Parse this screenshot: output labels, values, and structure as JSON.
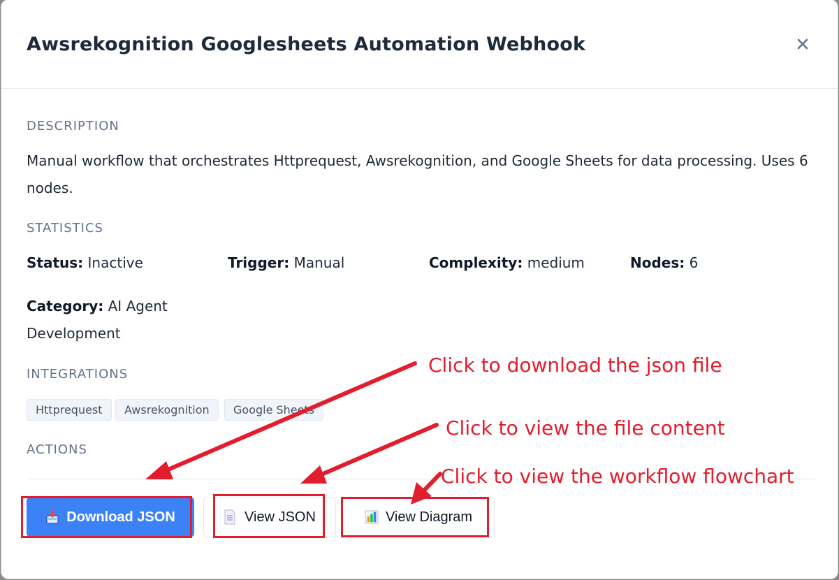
{
  "modal": {
    "title": "Awsrekognition Googlesheets Automation Webhook",
    "close_glyph": "×"
  },
  "description": {
    "label": "DESCRIPTION",
    "text": "Manual workflow that orchestrates Httprequest, Awsrekognition, and Google Sheets for data processing. Uses 6 nodes."
  },
  "statistics": {
    "label": "STATISTICS",
    "status": {
      "key": "Status:",
      "value": "Inactive"
    },
    "trigger": {
      "key": "Trigger:",
      "value": "Manual"
    },
    "complexity": {
      "key": "Complexity:",
      "value": "medium"
    },
    "nodes": {
      "key": "Nodes:",
      "value": "6"
    },
    "category": {
      "key": "Category:",
      "value": "AI Agent Development"
    }
  },
  "integrations": {
    "label": "INTEGRATIONS",
    "items": [
      "Httprequest",
      "Awsrekognition",
      "Google Sheets"
    ]
  },
  "actions": {
    "label": "ACTIONS",
    "download_json": "Download JSON",
    "view_json": "View JSON",
    "view_diagram": "View Diagram"
  },
  "annotations": {
    "download_note": "Click to download the json file",
    "view_note": "Click to view the file content",
    "diagram_note": "Click to view the workflow flowchart",
    "color": "#e11d2e"
  },
  "colors": {
    "primary_button": "#3b82f6",
    "title": "#1e293b",
    "section_label": "#64748b"
  },
  "icons": {
    "close": "close-icon",
    "download": "download-icon",
    "document": "document-icon",
    "chart": "bar-chart-icon"
  }
}
